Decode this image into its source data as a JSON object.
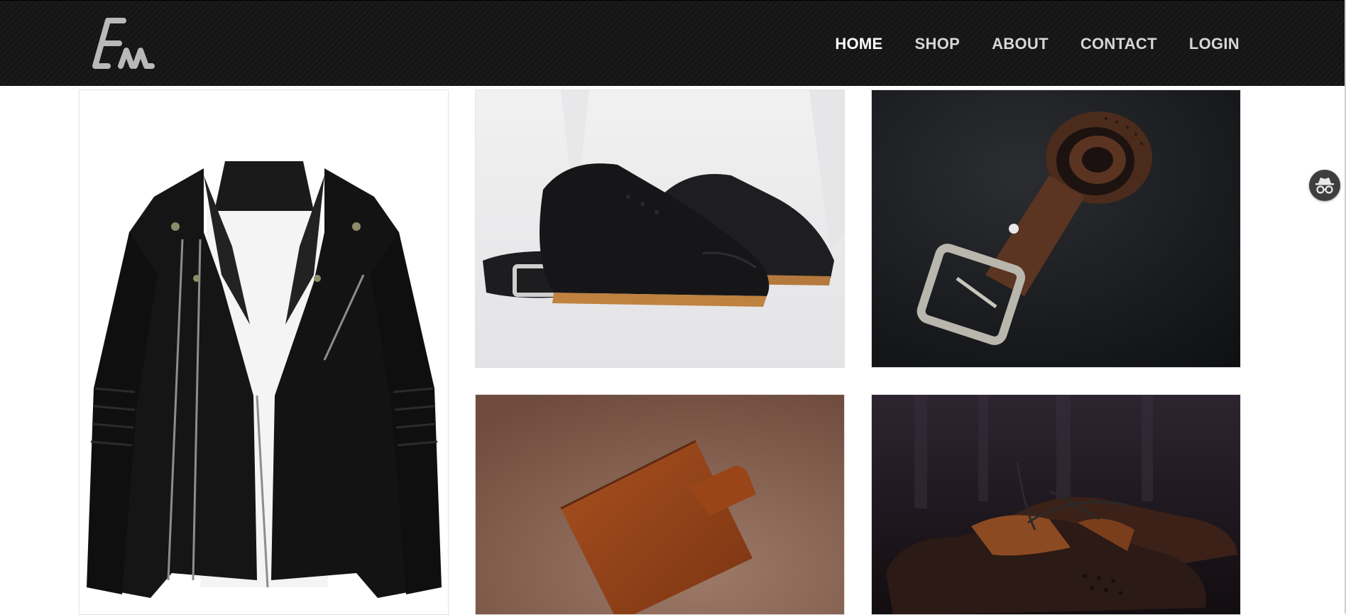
{
  "header": {
    "logo_icon": "brand-logo-icon",
    "nav": [
      {
        "label": "HOME",
        "active": true
      },
      {
        "label": "SHOP",
        "active": false
      },
      {
        "label": "ABOUT",
        "active": false
      },
      {
        "label": "CONTACT",
        "active": false
      },
      {
        "label": "LOGIN",
        "active": false
      }
    ]
  },
  "gallery": {
    "items": [
      {
        "icon": "leather-jacket-image",
        "description": "Black leather biker jacket"
      },
      {
        "icon": "black-oxford-shoes-image",
        "description": "Black oxford shoes with belt"
      },
      {
        "icon": "brown-belt-image",
        "description": "Rolled brown leather belt"
      },
      {
        "icon": "brown-wallet-image",
        "description": "Brown leather wallet"
      },
      {
        "icon": "brown-shoes-image",
        "description": "Brown leather shoes"
      }
    ]
  },
  "extension": {
    "icon": "incognito-icon"
  },
  "colors": {
    "header_bg": "#161616",
    "nav_active": "#ffffff",
    "nav_inactive": "#d7d7d7"
  }
}
